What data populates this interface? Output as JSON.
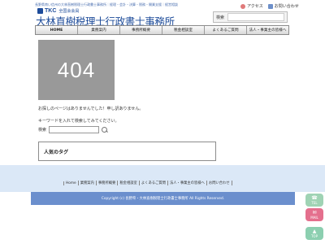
{
  "header": {
    "tagline": "長野県南い信州の大林直樹税理士行政書士事務所｜経理・会計・決算・税務・開業支援｜経営相談",
    "tkc_logo": "TKC",
    "tkc_sub": "全国会会員",
    "office_name": "大林直樹税理士行政書士事務所",
    "links": [
      {
        "label": "アクセス",
        "icon": "map-pin-icon"
      },
      {
        "label": "お問い合わせ",
        "icon": "mail-icon"
      }
    ],
    "search_label": "検索",
    "search_placeholder": ""
  },
  "nav": {
    "items": [
      {
        "label": "HOME"
      },
      {
        "label": "業務案内"
      },
      {
        "label": "事務所概要"
      },
      {
        "label": "税金相談室"
      },
      {
        "label": "よくあるご質問"
      },
      {
        "label": "法人・事業主の皆様へ"
      }
    ]
  },
  "main": {
    "error_code": "404",
    "message_not_found": "お探しのページはありませんでした！申し訳ありません。",
    "message_keyword": "キーワードを入れて検索してみてください。",
    "search_label": "検索",
    "search_placeholder": "",
    "tags_title": "人気のタグ"
  },
  "footer": {
    "links": [
      {
        "label": "Home"
      },
      {
        "label": "業務案内"
      },
      {
        "label": "事務所概要"
      },
      {
        "label": "税金相談室"
      },
      {
        "label": "よくあるご質問"
      },
      {
        "label": "法人・事業主の皆様へ"
      },
      {
        "label": "お問い合わせ"
      }
    ],
    "copyright": "Copyright (c) 長野県・大林直樹税理士行政書士事務所 All Rights Reserved."
  },
  "side_buttons": [
    {
      "label": "TEL",
      "icon": "phone-icon",
      "color": "#9fd3b4"
    },
    {
      "label": "MAIL",
      "icon": "mail-icon",
      "color": "#e46f8d"
    },
    {
      "label": "TOP",
      "icon": "arrow-up-icon",
      "color": "#8ccfb0"
    }
  ],
  "colors": {
    "brand_blue": "#1e4c9a",
    "footer_band": "#dbe8f7",
    "copyright_bar": "#6b8fcd",
    "placeholder_gray": "#999999"
  }
}
